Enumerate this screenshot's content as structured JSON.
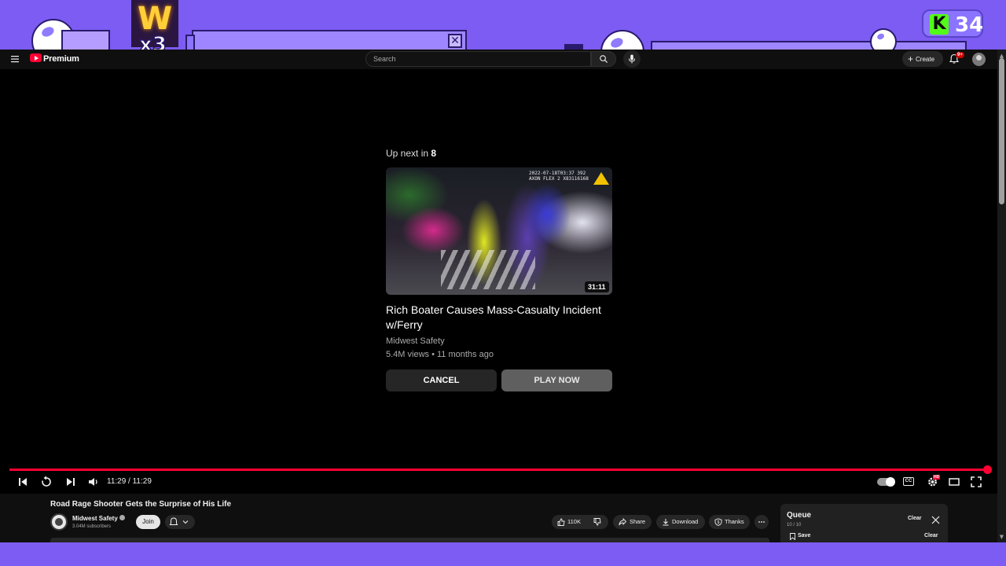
{
  "overlay": {
    "w_letter": "W",
    "w_multiplier": "x3",
    "kick_logo": "K",
    "kick_count": "34",
    "close_glyph": "✕"
  },
  "header": {
    "brand": "Premium",
    "search_placeholder": "Search",
    "create_label": "Create",
    "notification_badge": "9+"
  },
  "upnext": {
    "label": "Up next in",
    "countdown": "8",
    "thumbnail_stamp": "2022-07-18T03:37 392\nAXON FLEX 2 X83116168",
    "duration": "31:11",
    "title": "Rich Boater Causes Mass-Casualty Incident w/Ferry",
    "channel": "Midwest Safety",
    "meta": "5.4M views • 11 months ago",
    "cancel_label": "CANCEL",
    "play_label": "PLAY NOW"
  },
  "player": {
    "progress_fraction": 1.0,
    "time": "11:29 / 11:29",
    "cc_label": "CC",
    "hd_badge": "HD",
    "accent_color": "#ff0033"
  },
  "video": {
    "title": "Road Rage Shooter Gets the Surprise of His Life",
    "channel": "Midwest Safety",
    "subscribers": "3.04M subscribers",
    "join_label": "Join",
    "likes": "110K",
    "share_label": "Share",
    "download_label": "Download",
    "thanks_label": "Thanks"
  },
  "queue": {
    "title": "Queue",
    "count": "10 / 10",
    "clear_label": "Clear",
    "save_label": "Save",
    "clear_label_2": "Clear"
  },
  "icons": [
    "hamburger-icon",
    "search-icon",
    "mic-icon",
    "bell-icon",
    "prev-icon",
    "replay-icon",
    "next-icon",
    "volume-icon",
    "settings-icon",
    "theater-icon",
    "fullscreen-icon",
    "like-icon",
    "dislike-icon",
    "share-icon",
    "download-icon",
    "thanks-icon",
    "more-icon",
    "close-icon",
    "save-icon"
  ]
}
